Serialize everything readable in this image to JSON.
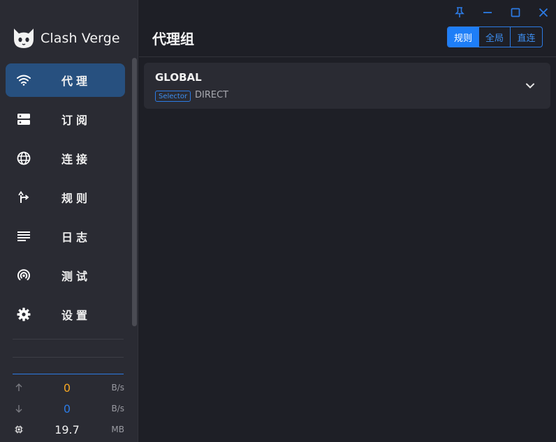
{
  "app": {
    "name": "Clash Verge"
  },
  "sidebar": {
    "items": [
      {
        "label": "代理",
        "icon": "wifi-icon",
        "active": true
      },
      {
        "label": "订阅",
        "icon": "server-icon",
        "active": false
      },
      {
        "label": "连接",
        "icon": "globe-icon",
        "active": false
      },
      {
        "label": "规则",
        "icon": "fork-icon",
        "active": false
      },
      {
        "label": "日志",
        "icon": "list-icon",
        "active": false
      },
      {
        "label": "测试",
        "icon": "radar-icon",
        "active": false
      },
      {
        "label": "设置",
        "icon": "gear-icon",
        "active": false
      }
    ]
  },
  "traffic": {
    "upload": {
      "value": "0",
      "unit": "B/s",
      "color": "#f5a623"
    },
    "download": {
      "value": "0",
      "unit": "B/s",
      "color": "#2c7be5"
    },
    "memory": {
      "value": "19.7",
      "unit": "MB"
    }
  },
  "main": {
    "title": "代理组",
    "modes": [
      {
        "label": "规则",
        "active": true
      },
      {
        "label": "全局",
        "active": false
      },
      {
        "label": "直连",
        "active": false
      }
    ],
    "groups": [
      {
        "name": "GLOBAL",
        "type": "Selector",
        "now": "DIRECT"
      }
    ]
  },
  "colors": {
    "accent": "#1e7ef7",
    "active_nav": "#27507f",
    "titlebar_icons": "#2c7be5"
  }
}
